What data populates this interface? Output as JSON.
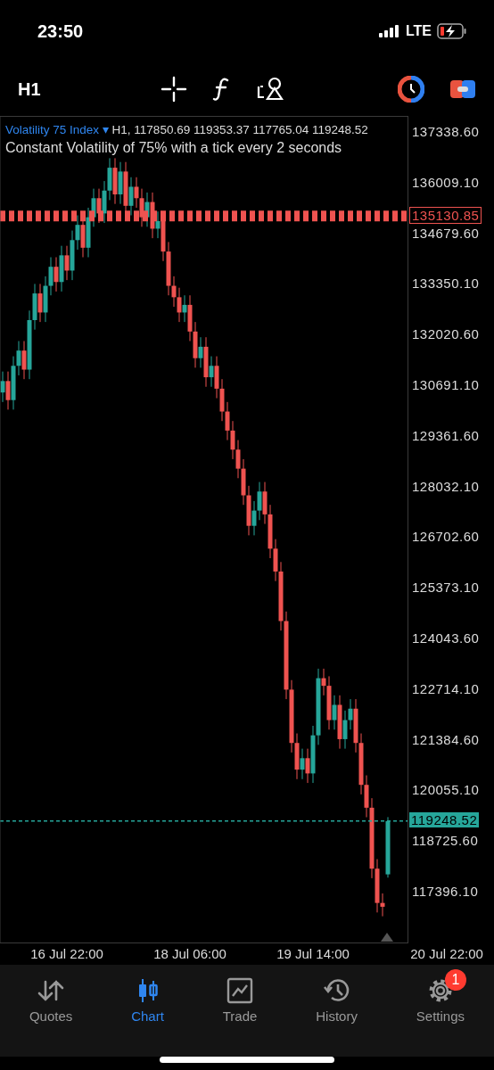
{
  "status_bar": {
    "time": "23:50",
    "network": "LTE"
  },
  "toolbar": {
    "timeframe": "H1"
  },
  "chart": {
    "symbol": "Volatility 75 Index",
    "symbol_caret": "▾",
    "ohlc": "H1, 117850.69 119353.37 117765.04 119248.52",
    "description": "Constant Volatility of 75% with a tick every 2 seconds",
    "order_price": "135130.85",
    "current_price": "119248.52",
    "chart_data": {
      "type": "candlestick",
      "ylim": [
        116038.6,
        137759.9
      ],
      "ref_lines": [
        {
          "axis": "y",
          "value": 135130.85,
          "color": "#ef5350"
        },
        {
          "axis": "y",
          "value": 119248.52,
          "color": "#26a69a"
        }
      ],
      "categories": [
        null,
        null,
        null,
        null,
        null,
        null,
        null,
        null,
        null,
        null,
        null,
        null,
        "16 Jul 22:00",
        null,
        null,
        null,
        null,
        null,
        null,
        null,
        null,
        null,
        null,
        null,
        null,
        null,
        null,
        null,
        null,
        null,
        null,
        null,
        null,
        null,
        null,
        "18 Jul 06:00",
        null,
        null,
        null,
        null,
        null,
        null,
        null,
        null,
        null,
        null,
        null,
        null,
        null,
        null,
        null,
        null,
        null,
        null,
        null,
        null,
        null,
        null,
        "19 Jul 14:00",
        null,
        null,
        null,
        null,
        null,
        null,
        null,
        null,
        null,
        null,
        null,
        null,
        null,
        null,
        null,
        null,
        null,
        null,
        null,
        null,
        null,
        null,
        null,
        null,
        "20 Jul 22:00"
      ],
      "yticks": [
        {
          "value": 137338.6,
          "label": "137338.60"
        },
        {
          "value": 136009.1,
          "label": "136009.10"
        },
        {
          "value": 134679.6,
          "label": "134679.60"
        },
        {
          "value": 133350.1,
          "label": "133350.10"
        },
        {
          "value": 132020.6,
          "label": "132020.60"
        },
        {
          "value": 130691.1,
          "label": "130691.10"
        },
        {
          "value": 129361.6,
          "label": "129361.60"
        },
        {
          "value": 128032.1,
          "label": "128032.10"
        },
        {
          "value": 126702.6,
          "label": "126702.60"
        },
        {
          "value": 125373.1,
          "label": "125373.10"
        },
        {
          "value": 124043.6,
          "label": "124043.60"
        },
        {
          "value": 122714.1,
          "label": "122714.10"
        },
        {
          "value": 121384.6,
          "label": "121384.60"
        },
        {
          "value": 120055.1,
          "label": "120055.10"
        },
        {
          "value": 118725.6,
          "label": "118725.60"
        },
        {
          "value": 117396.1,
          "label": "117396.10"
        }
      ],
      "ohlc": [
        [
          130500,
          131050,
          130250,
          130800
        ],
        [
          130800,
          131050,
          130050,
          130300
        ],
        [
          130300,
          131450,
          130050,
          131200
        ],
        [
          131200,
          131850,
          130950,
          131600
        ],
        [
          131600,
          131850,
          130850,
          131100
        ],
        [
          131100,
          132650,
          130850,
          132400
        ],
        [
          132400,
          133350,
          132150,
          133100
        ],
        [
          133100,
          133350,
          132350,
          132600
        ],
        [
          132600,
          133550,
          132350,
          133300
        ],
        [
          133300,
          134050,
          133050,
          133800
        ],
        [
          133800,
          134050,
          133150,
          133400
        ],
        [
          133400,
          134350,
          133150,
          134100
        ],
        [
          134100,
          134350,
          133450,
          133700
        ],
        [
          133700,
          134750,
          133450,
          134500
        ],
        [
          134500,
          135150,
          134250,
          134900
        ],
        [
          134900,
          135150,
          134050,
          134300
        ],
        [
          134300,
          135350,
          134050,
          135100
        ],
        [
          135100,
          135850,
          134850,
          135600
        ],
        [
          135600,
          135850,
          134950,
          135200
        ],
        [
          135200,
          136050,
          134950,
          135800
        ],
        [
          135800,
          136650,
          135550,
          136400
        ],
        [
          136400,
          136650,
          135450,
          135700
        ],
        [
          135700,
          136550,
          135450,
          136300
        ],
        [
          136300,
          136550,
          135150,
          135400
        ],
        [
          135400,
          136150,
          135150,
          135900
        ],
        [
          135900,
          136150,
          135350,
          135600
        ],
        [
          135600,
          135850,
          134850,
          135100
        ],
        [
          135100,
          135750,
          134850,
          135500
        ],
        [
          135500,
          135750,
          134550,
          134800
        ],
        [
          134800,
          135250,
          134550,
          135000
        ],
        [
          135000,
          135250,
          133950,
          134200
        ],
        [
          134200,
          134450,
          133050,
          133300
        ],
        [
          133300,
          133550,
          132750,
          133000
        ],
        [
          133000,
          133250,
          132350,
          132600
        ],
        [
          132600,
          133050,
          132350,
          132800
        ],
        [
          132800,
          133050,
          131850,
          132100
        ],
        [
          132100,
          132350,
          131150,
          131400
        ],
        [
          131400,
          131950,
          131150,
          131700
        ],
        [
          131700,
          131950,
          130650,
          130900
        ],
        [
          130900,
          131450,
          130650,
          131200
        ],
        [
          131200,
          131450,
          130350,
          130600
        ],
        [
          130600,
          130850,
          129750,
          130000
        ],
        [
          130000,
          130250,
          129250,
          129500
        ],
        [
          129500,
          129750,
          128750,
          129000
        ],
        [
          129000,
          129250,
          128250,
          128500
        ],
        [
          128500,
          128750,
          127550,
          127800
        ],
        [
          127800,
          128050,
          126750,
          127000
        ],
        [
          127000,
          127650,
          126750,
          127400
        ],
        [
          127400,
          128150,
          127150,
          127900
        ],
        [
          127900,
          128150,
          127050,
          127300
        ],
        [
          127300,
          127550,
          126150,
          126400
        ],
        [
          126400,
          126650,
          125550,
          125800
        ],
        [
          125800,
          126050,
          124250,
          124500
        ],
        [
          124500,
          124750,
          122450,
          122700
        ],
        [
          122700,
          122950,
          121050,
          121300
        ],
        [
          121300,
          121550,
          120350,
          120600
        ],
        [
          120600,
          121150,
          120350,
          120900
        ],
        [
          120900,
          121150,
          120250,
          120500
        ],
        [
          120500,
          121750,
          120250,
          121500
        ],
        [
          121500,
          123250,
          121250,
          123000
        ],
        [
          123000,
          123250,
          122550,
          122800
        ],
        [
          122800,
          123050,
          121650,
          121900
        ],
        [
          121900,
          122550,
          121650,
          122300
        ],
        [
          122300,
          122550,
          121150,
          121400
        ],
        [
          121400,
          122150,
          121150,
          121900
        ],
        [
          121900,
          122450,
          121650,
          122200
        ],
        [
          122200,
          122450,
          121050,
          121300
        ],
        [
          121300,
          121550,
          119950,
          120200
        ],
        [
          120200,
          120450,
          119350,
          119600
        ],
        [
          119600,
          119850,
          117750,
          118000
        ],
        [
          118000,
          118250,
          116850,
          117100
        ],
        [
          117100,
          117350,
          116750,
          117000
        ],
        [
          117850.69,
          119353.37,
          117765.04,
          119248.52
        ],
        null,
        null,
        null,
        null,
        null,
        null,
        null,
        null,
        null,
        null,
        null
      ]
    }
  },
  "tabs": [
    {
      "label": "Quotes",
      "selected": false,
      "kind": "quotes"
    },
    {
      "label": "Chart",
      "selected": true,
      "kind": "chart"
    },
    {
      "label": "Trade",
      "selected": false,
      "kind": "trade"
    },
    {
      "label": "History",
      "selected": false,
      "kind": "history"
    },
    {
      "label": "Settings",
      "selected": false,
      "kind": "settings",
      "badge": "1"
    }
  ]
}
